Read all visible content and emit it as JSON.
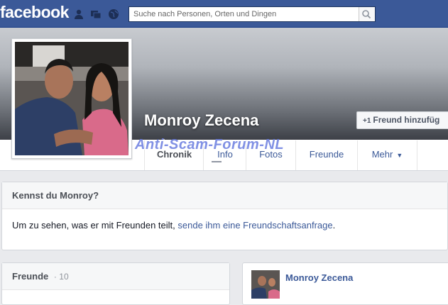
{
  "topbar": {
    "logo": "facebook",
    "search_placeholder": "Suche nach Personen, Orten und Dingen"
  },
  "profile": {
    "name": "Monroy Zecena",
    "add_friend_label": "Freund hinzufüg",
    "add_friend_prefix": "+1"
  },
  "tabs": [
    {
      "label": "Chronik"
    },
    {
      "label": "Info"
    },
    {
      "label": "Fotos"
    },
    {
      "label": "Freunde"
    },
    {
      "label": "Mehr"
    }
  ],
  "watermark": "Anti-Scam-Forum-NL",
  "know_card": {
    "title": "Kennst du Monroy?",
    "text_before": "Um zu sehen, was er mit Freunden teilt, ",
    "link": "sende ihm eine Freundschaftsanfrage",
    "text_after": "."
  },
  "friends_card": {
    "title": "Freunde",
    "separator": "·",
    "count": "10"
  },
  "post": {
    "name": "Monroy Zecena"
  },
  "colors": {
    "brand": "#3b5998",
    "background": "#e9eaed"
  }
}
